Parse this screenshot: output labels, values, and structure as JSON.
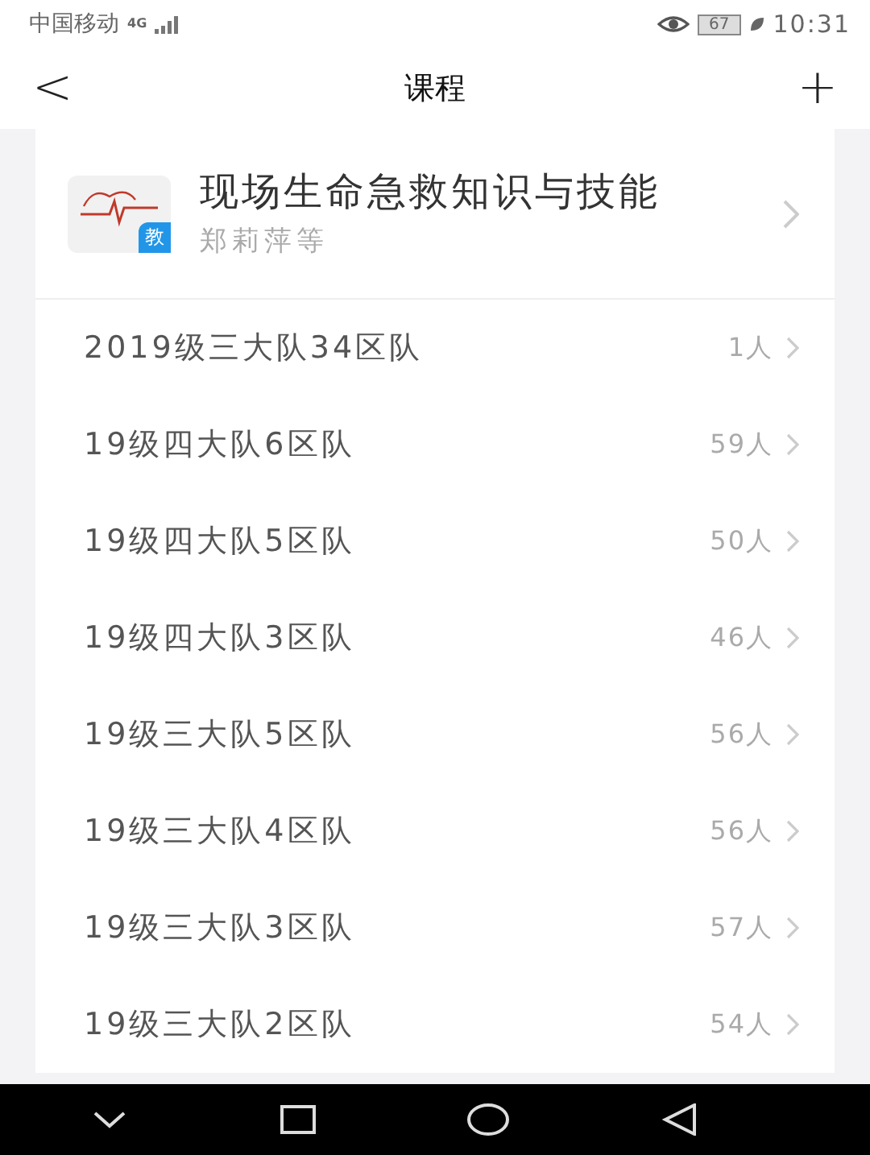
{
  "status_bar": {
    "carrier": "中国移动",
    "network": "4G",
    "battery": "67",
    "time": "10:31"
  },
  "header": {
    "back": "<",
    "title": "课程",
    "add": "+"
  },
  "course": {
    "title": "现场生命急救知识与技能",
    "badge": "教",
    "teachers": "郑莉萍等"
  },
  "classes": [
    {
      "name": "2019级三大队34区队",
      "count": "1人"
    },
    {
      "name": "19级四大队6区队",
      "count": "59人"
    },
    {
      "name": "19级四大队5区队",
      "count": "50人"
    },
    {
      "name": "19级四大队3区队",
      "count": "46人"
    },
    {
      "name": "19级三大队5区队",
      "count": "56人"
    },
    {
      "name": "19级三大队4区队",
      "count": "56人"
    },
    {
      "name": "19级三大队3区队",
      "count": "57人"
    },
    {
      "name": "19级三大队2区队",
      "count": "54人"
    }
  ]
}
